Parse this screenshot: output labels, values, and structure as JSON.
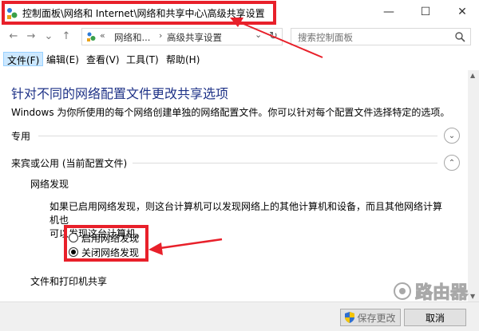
{
  "window": {
    "title": "控制面板\\网络和 Internet\\网络和共享中心\\高级共享设置",
    "minimize": "—",
    "maximize": "☐",
    "close": "✕"
  },
  "nav": {
    "back": "←",
    "forward": "→",
    "dropdown": "⌄",
    "up": "↑",
    "breadcrumb_overflow": "«",
    "breadcrumb_1": "网络和...",
    "breadcrumb_sep": "›",
    "breadcrumb_2": "高级共享设置",
    "addr_dropdown": "⌄",
    "refresh": "↻",
    "search_placeholder": "搜索控制面板"
  },
  "menu": [
    {
      "label": "文件(F)"
    },
    {
      "label": "编辑(E)"
    },
    {
      "label": "查看(V)"
    },
    {
      "label": "工具(T)"
    },
    {
      "label": "帮助(H)"
    }
  ],
  "content": {
    "title": "针对不同的网络配置文件更改共享选项",
    "description": "Windows 为你所使用的每个网络创建单独的网络配置文件。你可以针对每个配置文件选择特定的选项。",
    "section_private": "专用",
    "section_public": "来宾或公用 (当前配置文件)",
    "expand_down": "⌄",
    "expand_up": "⌃",
    "network_discovery_heading": "网络发现",
    "network_discovery_desc_1": "如果已启用网络发现，则这台计算机可以发现网络上的其他计算机和设备，而且其他网络计算机也",
    "network_discovery_desc_2": "可以发现这台计算机。",
    "radio_on": "启用网络发现",
    "radio_off": "关闭网络发现",
    "file_sharing_heading": "文件和打印机共享"
  },
  "buttons": {
    "save": "保存更改",
    "cancel": "取消"
  },
  "watermark": "路由器",
  "colors": {
    "title_blue": "#1e3287",
    "highlight_red": "#e8202a",
    "menu_active": "#cce8ff"
  },
  "state": {
    "network_discovery_selected": "off"
  }
}
